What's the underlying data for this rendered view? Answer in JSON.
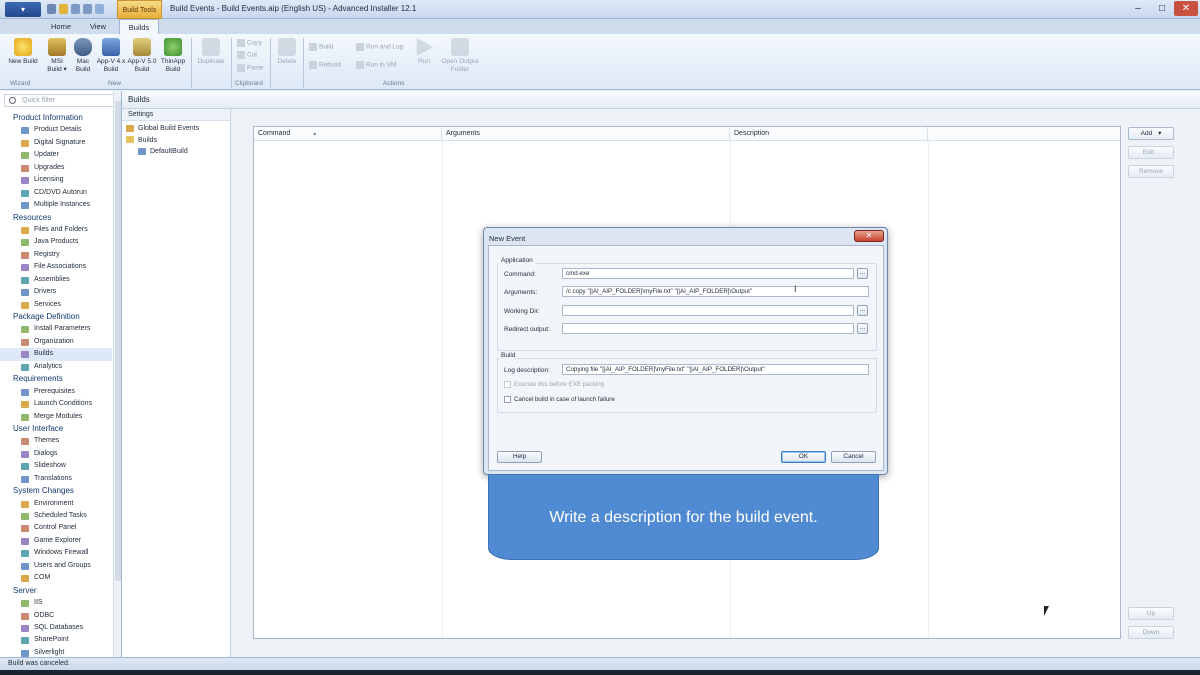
{
  "window": {
    "title": "Build Events - Build Events.aip (English US) - Advanced Installer 12.1",
    "context_tab": "Build Tools",
    "app_menu": "▾"
  },
  "tabs": [
    "Home",
    "View",
    "Builds"
  ],
  "ribbon": {
    "wizard": {
      "group": "Wizard",
      "new_build": "New Build"
    },
    "new": {
      "group": "New",
      "buttons": [
        "MSI Build ▾",
        "Mac Build",
        "App-V 4.x Build",
        "App-V 5.0 Build",
        "ThinApp Build"
      ]
    },
    "duplicate": "Duplicate",
    "clipboard": {
      "group": "Clipboard",
      "copy": "Copy",
      "cut": "Cut",
      "paste": "Paste"
    },
    "delete": "Delete",
    "actions": {
      "group": "Actions",
      "build": "Build",
      "rebuild": "Rebuild",
      "run_and_log": "Run and Log",
      "run_in_vm": "Run in VM",
      "run": "Run",
      "open_output_folder": "Open Output Folder"
    }
  },
  "sidebar": {
    "filter_placeholder": "Quick filter",
    "sections": [
      {
        "label": "Product Information",
        "items": [
          "Product Details",
          "Digital Signature",
          "Updater",
          "Upgrades",
          "Licensing",
          "CD/DVD Autorun",
          "Multiple Instances"
        ]
      },
      {
        "label": "Resources",
        "items": [
          "Files and Folders",
          "Java Products",
          "Registry",
          "File Associations",
          "Assemblies",
          "Drivers",
          "Services"
        ]
      },
      {
        "label": "Package Definition",
        "items": [
          "Install Parameters",
          "Organization",
          "Builds",
          "Analytics"
        ]
      },
      {
        "label": "Requirements",
        "items": [
          "Prerequisites",
          "Launch Conditions",
          "Merge Modules"
        ]
      },
      {
        "label": "User Interface",
        "items": [
          "Themes",
          "Dialogs",
          "Slideshow",
          "Translations"
        ]
      },
      {
        "label": "System Changes",
        "items": [
          "Environment",
          "Scheduled Tasks",
          "Control Panel",
          "Game Explorer",
          "Windows Firewall",
          "Users and Groups",
          "COM"
        ]
      },
      {
        "label": "Server",
        "items": [
          "IIS",
          "ODBC",
          "SQL Databases",
          "SharePoint",
          "Silverlight"
        ]
      }
    ],
    "selected": "Builds"
  },
  "panel": {
    "title": "Builds",
    "tree_header": "Settings",
    "tree": [
      "Global Build Events",
      "Builds",
      "DefaultBuild"
    ]
  },
  "grid": {
    "columns": [
      "Command",
      "Arguments",
      "Description"
    ],
    "sort_indicator": "▲"
  },
  "side_buttons": {
    "add": "Add",
    "add_arrow": "▾",
    "edit": "Edit...",
    "remove": "Remove",
    "up": "Up",
    "down": "Down"
  },
  "dialog": {
    "title": "New Event",
    "close": "✕",
    "application_group": "Application",
    "command_label": "Command:",
    "command_value": "cmd.exe",
    "arguments_label": "Arguments:",
    "arguments_value": "/c copy \"[|AI_AIP_FOLDER]\\myFile.txt\" \"[|AI_AIP_FOLDER]\\Output\"",
    "working_dir_label": "Working Dir:",
    "working_dir_value": "",
    "redirect_label": "Redirect output:",
    "redirect_value": "",
    "browse": "...",
    "build_group": "Build",
    "log_label": "Log description:",
    "log_value": "Copying file \"[|AI_AIP_FOLDER]\\myFile.txt\" \"[|AI_AIP_FOLDER]\\Output\"",
    "execute_before": "Execute this before EXE packing",
    "cancel_build": "Cancel build in case of launch failure",
    "help": "Help",
    "ok": "OK",
    "cancel": "Cancel"
  },
  "callout": "Write a description for the build event.",
  "status": "Build was canceled."
}
